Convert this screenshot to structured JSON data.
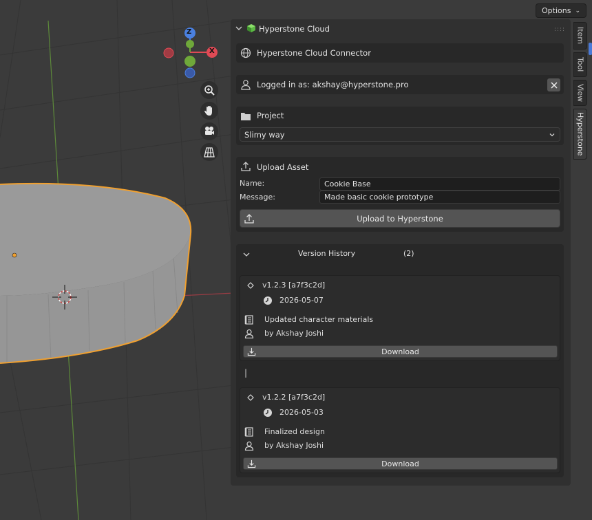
{
  "header": {
    "options_label": "Options"
  },
  "gizmo": {
    "axis_z": "Z",
    "axis_x": "X",
    "axis_y": "Y"
  },
  "side_tabs": [
    "Item",
    "Tool",
    "View",
    "Hyperstone"
  ],
  "panel": {
    "title": "Hyperstone Cloud",
    "connector_label": "Hyperstone Cloud Connector",
    "logged_in_label": "Logged in as: akshay@hyperstone.pro",
    "project": {
      "label": "Project",
      "selected": "Slimy way"
    },
    "upload": {
      "label": "Upload Asset",
      "name_label": "Name:",
      "name_value": "Cookie Base",
      "message_label": "Message:",
      "message_value": "Made basic cookie prototype",
      "button_label": "Upload to Hyperstone"
    },
    "history": {
      "label": "Version History",
      "count": "(2)",
      "versions": [
        {
          "tag": "v1.2.3 [a7f3c2d]",
          "date": "2026-05-07",
          "message": "Updated character materials",
          "author": "by Akshay Joshi",
          "download_label": "Download"
        },
        {
          "tag": "v1.2.2 [a7f3c2d]",
          "date": "2026-05-03",
          "message": "Finalized design",
          "author": "by Akshay Joshi",
          "download_label": "Download"
        }
      ],
      "separator": "|"
    }
  },
  "colors": {
    "viewport_bg": "#3b3b3b",
    "selection_outline": "#f0a030",
    "axis_x": "#e04a55",
    "axis_y": "#6fa83a",
    "axis_z": "#4a80e0",
    "panel_bg": "#303030",
    "accent": "#4a7ad8"
  }
}
